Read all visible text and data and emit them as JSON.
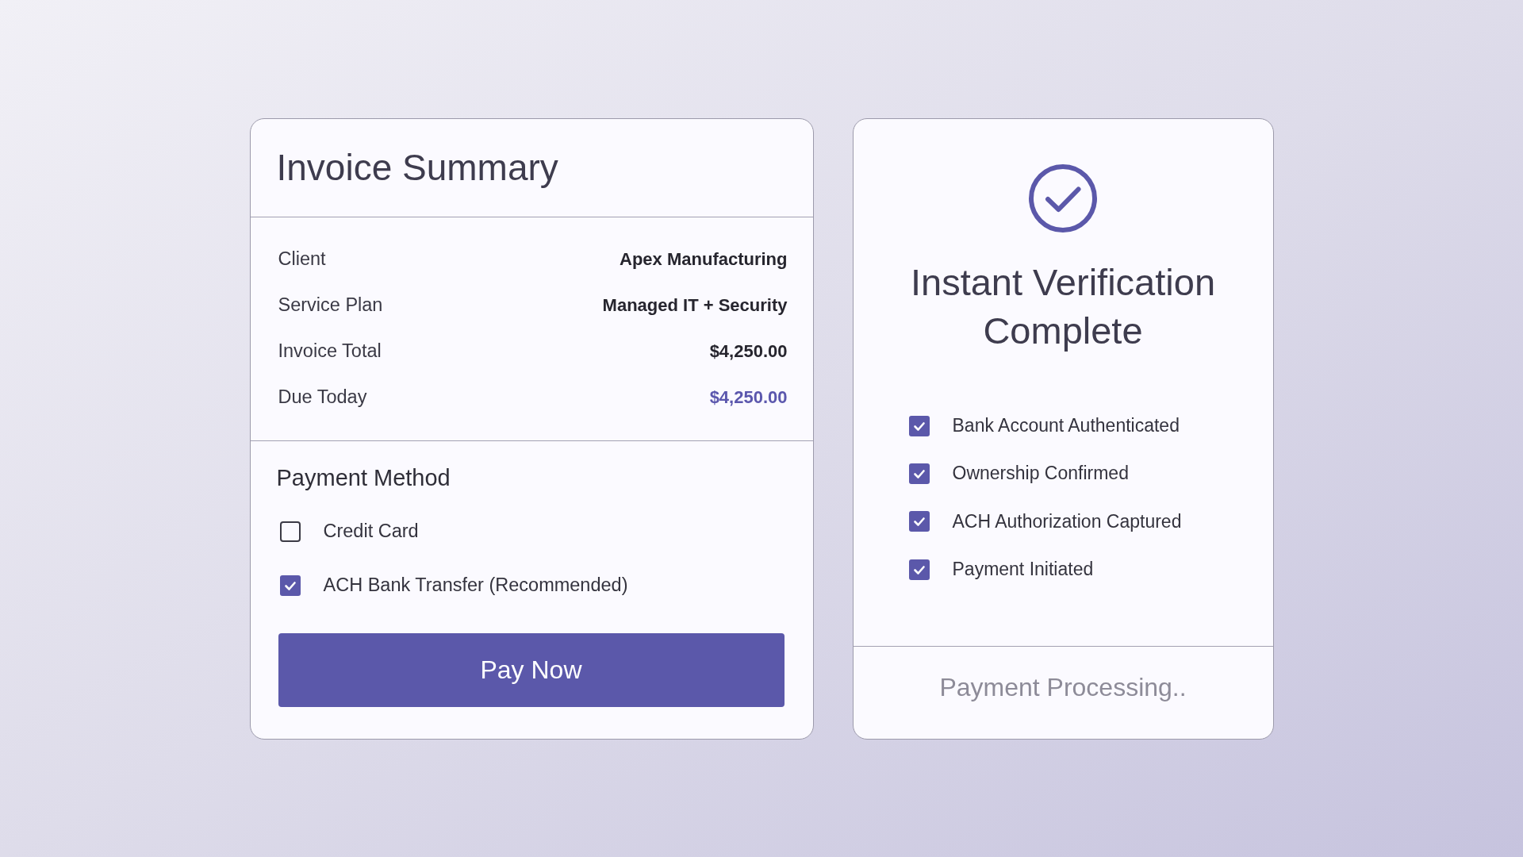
{
  "invoice_card": {
    "title": "Invoice Summary",
    "details": [
      {
        "label": "Client",
        "value": "Apex Manufacturing",
        "kind": "standard"
      },
      {
        "label": "Service Plan",
        "value": "Managed IT + Security",
        "kind": "standard"
      },
      {
        "label": "Invoice Total",
        "value": "$4,250.00",
        "kind": "standard"
      },
      {
        "label": "Due Today",
        "value": "$4,250.00",
        "kind": "due"
      }
    ],
    "payment_method": {
      "heading": "Payment Method",
      "options": [
        {
          "label": "Credit Card",
          "checked": false
        },
        {
          "label": "ACH Bank Transfer (Recommended)",
          "checked": true
        }
      ]
    },
    "button": "Pay Now"
  },
  "verification_card": {
    "title": "Instant Verification Complete",
    "steps": [
      {
        "label": "Bank Account Authenticated",
        "checked": true
      },
      {
        "label": "Ownership Confirmed",
        "checked": true
      },
      {
        "label": "ACH Authorization Captured",
        "checked": true
      },
      {
        "label": "Payment Initiated",
        "checked": true
      }
    ],
    "status": "Payment Processing.."
  }
}
